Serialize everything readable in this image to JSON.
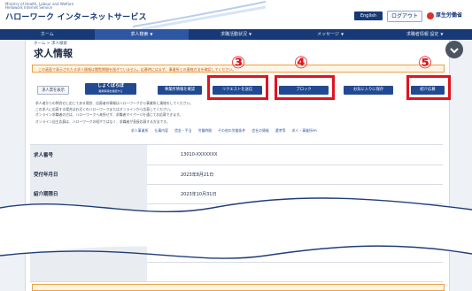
{
  "header": {
    "brand_small_line1": "Ministry of Health, Labour and Welfare",
    "brand_small_line2": "Hellowork Internet Service",
    "brand": "ハローワーク インターネットサービス",
    "lang_button": "English",
    "logout_button": "ログアウト",
    "mhlw_label": "厚生労働省"
  },
  "nav": {
    "items": [
      {
        "label": "ホーム"
      },
      {
        "label": "求人検索"
      },
      {
        "label": "求職活動状況"
      },
      {
        "label": "メッセージ"
      },
      {
        "label": "求職者情報 設定"
      }
    ]
  },
  "breadcrumb": "ホーム > 求人検索",
  "page_title": "求人情報",
  "notice": "この画面で表示されたる求人情報は閲覧期間を過ぎていません。応募時にはまず、事業所との連絡方法を確認してください。",
  "buttons": {
    "back": "求人票を表示",
    "shokuba": "しょくばらぼ",
    "shokuba_sub": "職場情報を確認する",
    "company_info": "事業所情報を確認",
    "request": "リクエストを送信",
    "block": "ブロック",
    "favorite": "お気に入りに保存",
    "apply": "紹介応募"
  },
  "callouts": [
    "③",
    "④",
    "⑤"
  ],
  "description": [
    "求人者からの問合せに応じてある場合、応募者の情報はハローワークから事業所に連絡をしてください。",
    "この求人に応募する場合はお近くのハローワークまたはオンラインから応募してください。",
    "オンライン求職者の方は、ハローワークへ来所せず、求職者マイページを通じてお応募できます。",
    "オンライン自主応募は、ハローワークの紹介ではなく、求職者が直接応募する方法です。"
  ],
  "anchor_links": [
    "求人事業所",
    "仕事内容",
    "賃金・手当",
    "労働時間",
    "その他の労働条件",
    "会社の情報",
    "選考等",
    "求人・事業所PR"
  ],
  "table": [
    {
      "label": "求人番号",
      "value": "13010-XXXXXXX"
    },
    {
      "label": "受付年月日",
      "value": "2023年8月21日"
    },
    {
      "label": "紹介期限日",
      "value": "2023年10月31日"
    }
  ],
  "colors": {
    "navy": "#173a77",
    "accent": "#2d56a3",
    "callout": "#e0141e",
    "notice": "#f0a040"
  }
}
